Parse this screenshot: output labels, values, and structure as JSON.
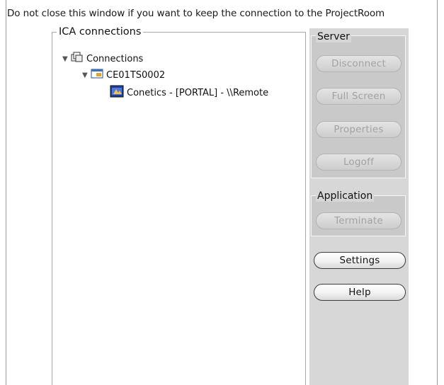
{
  "notice": "Do not close this window if you want to keep the connection to the ProjectRoom",
  "ica": {
    "title": "ICA connections",
    "tree": [
      {
        "label": "Connections",
        "icon": "connections-icon"
      },
      {
        "label": "CE01TS0002",
        "icon": "server-window-icon"
      },
      {
        "label": "Conetics - [PORTAL] - \\\\Remote",
        "icon": "app-session-icon"
      }
    ]
  },
  "server": {
    "title": "Server",
    "disconnect": "Disconnect",
    "fullscreen": "Full Screen",
    "properties": "Properties",
    "logoff": "Logoff"
  },
  "application": {
    "title": "Application",
    "terminate": "Terminate"
  },
  "settings": "Settings",
  "help": "Help"
}
